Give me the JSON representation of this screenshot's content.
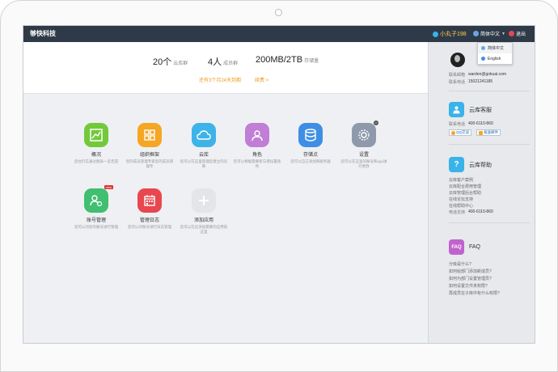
{
  "app": {
    "brand": "够快科技"
  },
  "topbar": {
    "user_name": "小丸子198",
    "language": "简体中文",
    "logout": "退出"
  },
  "language_menu": {
    "options": [
      "简体中文",
      "English"
    ],
    "selected": "简体中文"
  },
  "stats": {
    "libraries": {
      "value": "20个",
      "unit": "云库群"
    },
    "members": {
      "value": "4人",
      "unit": "成员群"
    },
    "storage": {
      "value": "200MB/2TB",
      "unit": "存储量"
    },
    "expire_notice": "还有3个月24天到期",
    "renew": "续费 >"
  },
  "apps": [
    {
      "title": "概况",
      "desc": "后台仍实通过图表一览无遗",
      "color": "#72c93a",
      "icon": "chart-icon"
    },
    {
      "title": "组织框架",
      "desc": "您的成员管理专家您的成员管理专",
      "color": "#f5a623",
      "icon": "org-icon"
    },
    {
      "title": "云库",
      "desc": "您可以在这里管理您建立的云库",
      "color": "#3db3e8",
      "icon": "cloud-icon"
    },
    {
      "title": "角色",
      "desc": "您可以根据需要新与增设置角色",
      "color": "#c07ed6",
      "icon": "role-icon"
    },
    {
      "title": "存储点",
      "desc": "您可以自己添加和服务器",
      "color": "#3e8fe4",
      "icon": "database-icon"
    },
    {
      "title": "设置",
      "desc": "您可以在这里的账号和ogo进行更改",
      "color": "#8e9aab",
      "icon": "gear-icon"
    },
    {
      "title": "账号管理",
      "desc": "您可以对您的账号进行管理",
      "color": "#3fbf6f",
      "icon": "account-icon",
      "badge": "new"
    },
    {
      "title": "管理日志",
      "desc": "您可以对账号进行日志管理",
      "color": "#e8474f",
      "icon": "calendar-icon"
    },
    {
      "title": "添加应用",
      "desc": "您可以在这添加需要的应用就这里",
      "color": "#e3e5e8",
      "icon": "plus-icon"
    }
  ],
  "profile": {
    "email_label": "联系邮箱",
    "email": "warden@gokuai.com",
    "phone_label": "联系电话",
    "phone": "15021241185"
  },
  "support": {
    "title": "云库客服",
    "phone_label": "联系电话",
    "phone": "400-6110-860",
    "qq_button": "QQ交谈",
    "mail_button": "发送邮件"
  },
  "help": {
    "title": "云库帮助",
    "links": [
      "云库客户案例",
      "云库配合费用管理",
      "云库管理后台帮助",
      "在线论坛支持",
      "在线帮助中心"
    ],
    "phone_label": "电话支持",
    "phone": "400-6110-860"
  },
  "faq": {
    "icon_text": "FAQ",
    "title": "FAQ",
    "links": [
      "分级是什么?",
      "如何给部门添加新成员?",
      "如何为部门设置管理员?",
      "如何设置文件夹权限?",
      "再成员在子库中有什么权限?"
    ]
  },
  "colors": {
    "topbar": "#2f3a48",
    "accent": "#f19a1f",
    "link": "#1d66b3"
  }
}
